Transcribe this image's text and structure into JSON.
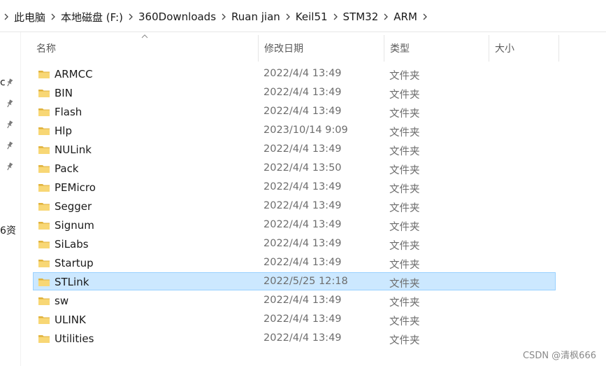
{
  "breadcrumb": {
    "items": [
      "此电脑",
      "本地磁盘 (F:)",
      "360Downloads",
      "Ruan jian",
      "Keil51",
      "STM32",
      "ARM"
    ]
  },
  "nav": {
    "truncated_top": "c",
    "truncated_bottom": "6资"
  },
  "columns": {
    "name": "名称",
    "modified": "修改日期",
    "type": "类型",
    "size": "大小",
    "sorted_by": "name"
  },
  "rows": [
    {
      "name": "ARMCC",
      "modified": "2022/4/4 13:49",
      "type": "文件夹",
      "selected": false
    },
    {
      "name": "BIN",
      "modified": "2022/4/4 13:49",
      "type": "文件夹",
      "selected": false
    },
    {
      "name": "Flash",
      "modified": "2022/4/4 13:49",
      "type": "文件夹",
      "selected": false
    },
    {
      "name": "Hlp",
      "modified": "2023/10/14 9:09",
      "type": "文件夹",
      "selected": false
    },
    {
      "name": "NULink",
      "modified": "2022/4/4 13:49",
      "type": "文件夹",
      "selected": false
    },
    {
      "name": "Pack",
      "modified": "2022/4/4 13:50",
      "type": "文件夹",
      "selected": false
    },
    {
      "name": "PEMicro",
      "modified": "2022/4/4 13:49",
      "type": "文件夹",
      "selected": false
    },
    {
      "name": "Segger",
      "modified": "2022/4/4 13:49",
      "type": "文件夹",
      "selected": false
    },
    {
      "name": "Signum",
      "modified": "2022/4/4 13:49",
      "type": "文件夹",
      "selected": false
    },
    {
      "name": "SiLabs",
      "modified": "2022/4/4 13:49",
      "type": "文件夹",
      "selected": false
    },
    {
      "name": "Startup",
      "modified": "2022/4/4 13:49",
      "type": "文件夹",
      "selected": false
    },
    {
      "name": "STLink",
      "modified": "2022/5/25 12:18",
      "type": "文件夹",
      "selected": true
    },
    {
      "name": "sw",
      "modified": "2022/4/4 13:49",
      "type": "文件夹",
      "selected": false
    },
    {
      "name": "ULINK",
      "modified": "2022/4/4 13:49",
      "type": "文件夹",
      "selected": false
    },
    {
      "name": "Utilities",
      "modified": "2022/4/4 13:49",
      "type": "文件夹",
      "selected": false
    }
  ],
  "watermark": "CSDN @清枫666",
  "colors": {
    "selection_bg": "#cce8ff",
    "selection_border": "#99d1ff",
    "folder_yellow": "#f8d775",
    "folder_dark": "#e0b23c",
    "secondary_text": "#6d6d6d"
  },
  "icons": {
    "folder": "folder-icon",
    "pin": "pin-icon",
    "breadcrumb_separator": "chevron-right-icon",
    "sort": "sort-ascending-icon"
  }
}
